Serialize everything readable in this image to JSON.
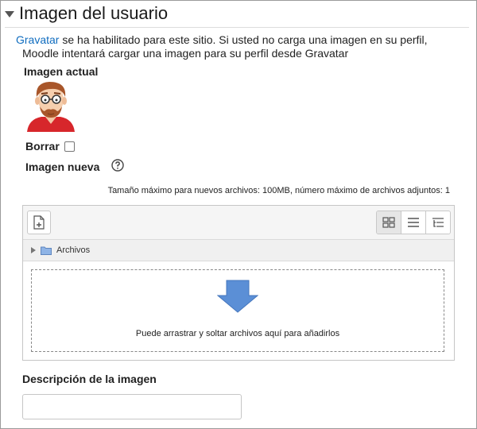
{
  "section": {
    "title": "Imagen del usuario",
    "gravatar_link": "Gravatar",
    "notice_line1_rest": "se ha habilitado para este sitio. Si usted no carga una imagen en su perfil,",
    "notice_line2": "Moodle  intentará cargar una imagen para su perfil desde Gravatar"
  },
  "current_image": {
    "label": "Imagen actual",
    "avatar_icon": "user-avatar-illustration"
  },
  "delete": {
    "label": "Borrar",
    "checked": false
  },
  "new_image": {
    "label": "Imagen nueva",
    "help_icon": "question-circle-icon",
    "limits_text": "Tamaño máximo para nuevos archivos: 100MB, número máximo de archivos adjuntos: 1"
  },
  "filepicker": {
    "add_icon": "file-add-icon",
    "view_icons": [
      "grid-view-icon",
      "list-view-icon",
      "tree-view-icon"
    ],
    "path_label": "Archivos",
    "drop_text": "Puede arrastrar y soltar archivos aquí para añadirlos"
  },
  "description": {
    "label": "Descripción de la imagen",
    "value": "",
    "placeholder": ""
  },
  "colors": {
    "link": "#0f6cbf",
    "arrow": "#5b8fd6",
    "border": "#c6c6c6"
  }
}
